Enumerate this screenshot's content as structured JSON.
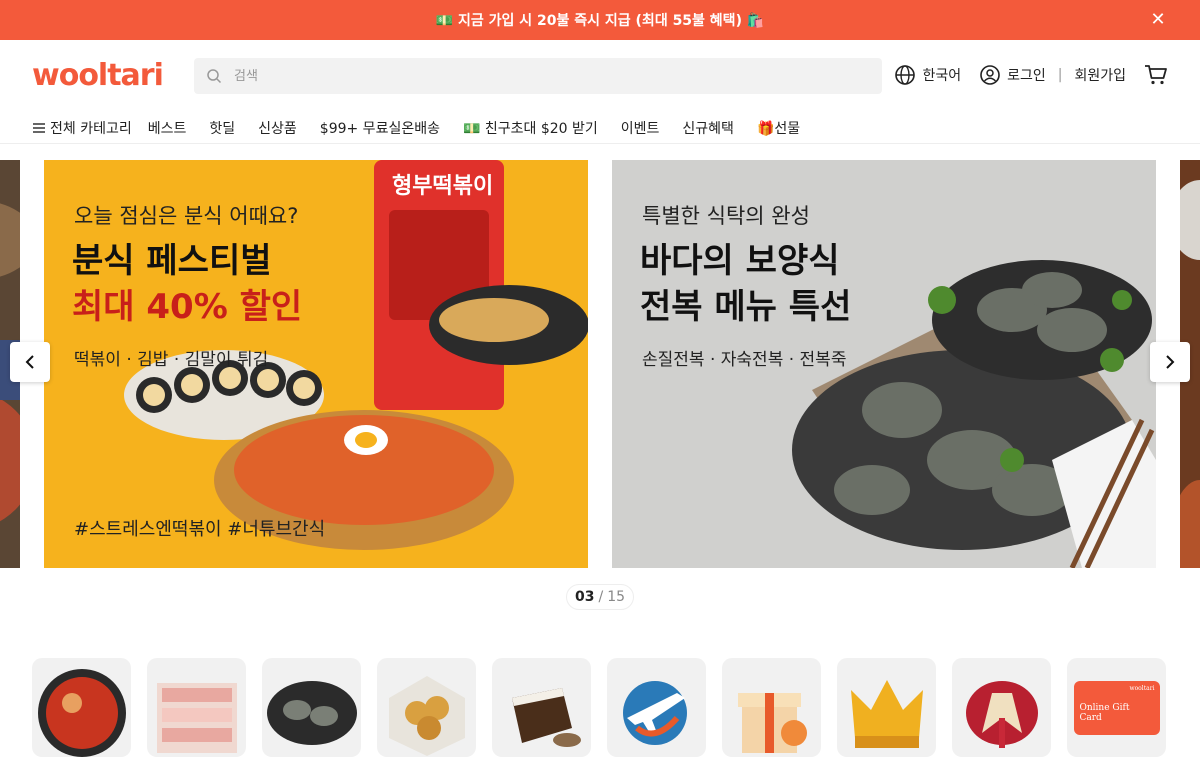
{
  "promo": {
    "text": "💵 지금 가입 시 20불 즉시 지급 (최대 55불 혜택) 🛍️",
    "close_icon": "close-icon"
  },
  "header": {
    "logo": "wooltari",
    "search_placeholder": "검색",
    "language": "한국어",
    "login": "로그인",
    "signup": "회원가입"
  },
  "nav": {
    "all_categories": "전체 카테고리",
    "items": [
      "베스트",
      "핫딜",
      "신상품",
      "$99+ 무료실온배송",
      "💵 친구초대 $20 받기",
      "이벤트",
      "신규혜택",
      "🎁선물"
    ]
  },
  "banners": [
    {
      "subtitle": "오늘 점심은 분식 어때요?",
      "title_line1": "분식 페스티벌",
      "title_line2": "최대 40% 할인",
      "items": "떡볶이 · 김밥 · 김말이 튀김",
      "tags": "#스트레스엔떡볶이 #너튜브간식",
      "package_text": "형부떡볶이"
    },
    {
      "subtitle": "특별한 식탁의 완성",
      "title_line1": "바다의 보양식",
      "title_line2": "전복 메뉴 특선",
      "items": "손질전복 · 자숙전복 · 전복죽"
    }
  ],
  "pager": {
    "current": "03",
    "separator": "/",
    "total": "15"
  },
  "category_tiles": [
    "kimchi-icon",
    "pork-belly-icon",
    "abalone-icon",
    "fried-snack-icon",
    "rice-icon",
    "airplane-icon",
    "gift-box-icon",
    "vip-crown-icon",
    "gift-bundle-icon",
    "gift-card-icon"
  ],
  "gift_card_text": "Online Gift Card",
  "gift_card_brand": "wooltari",
  "colors": {
    "brand": "#f35a3b",
    "promo_bg": "#f35a3b",
    "banner1_bg": "#f6b21d",
    "accent_red": "#c8201a"
  }
}
